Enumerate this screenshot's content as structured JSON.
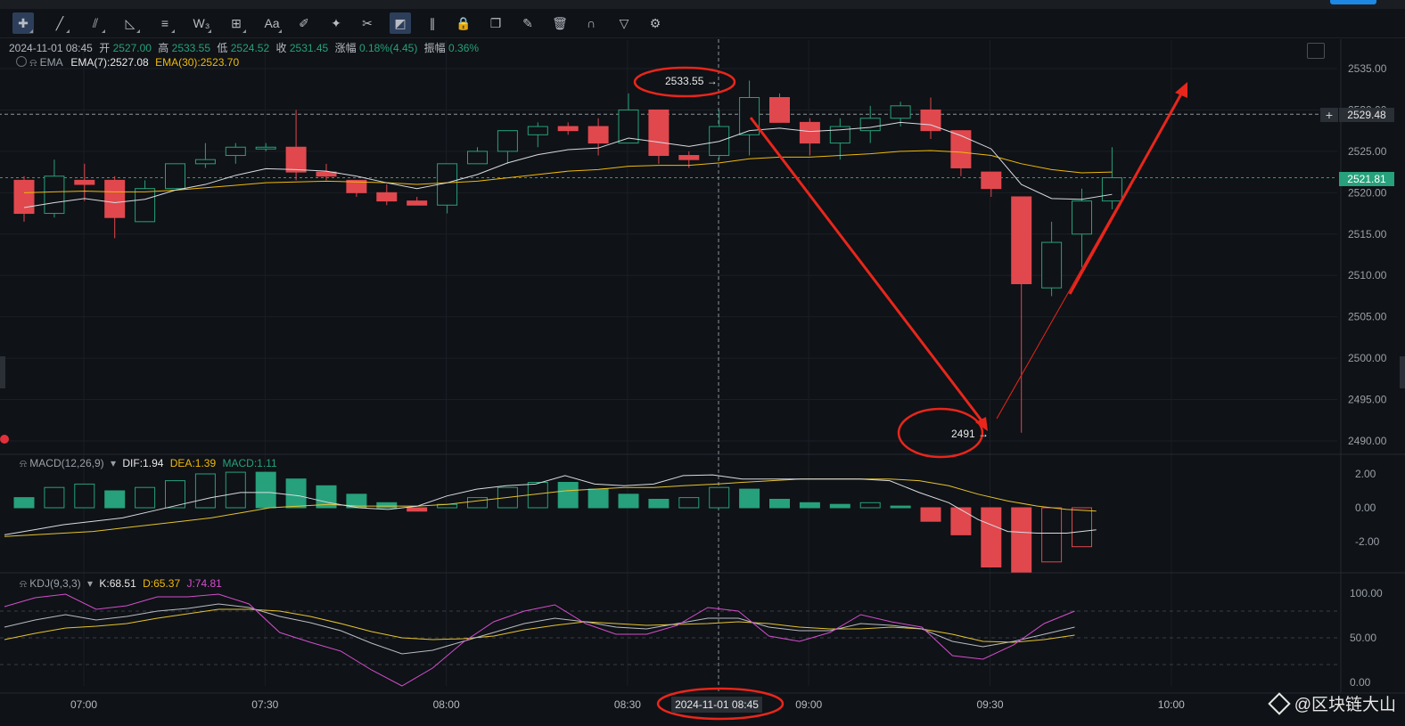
{
  "toolbar": {
    "tools": [
      "crosshair-icon",
      "trend-line-icon",
      "parallel-channel-icon",
      "fib-icon",
      "horizontal-line-icon",
      "pattern-icon",
      "measure-icon",
      "text-icon",
      "brush-icon",
      "highlighter-icon",
      "ruler-icon",
      "long-position-icon",
      "candles-icon",
      "lock-icon",
      "copy-icon",
      "edit-icon",
      "trash-icon",
      "magnet-icon",
      "filter-icon",
      "settings-icon"
    ]
  },
  "ohlc": {
    "datetime": "2024-11-01 08:45",
    "open_label": "开",
    "open": "2527.00",
    "high_label": "高",
    "high": "2533.55",
    "low_label": "低",
    "low": "2524.52",
    "close_label": "收",
    "close": "2531.45",
    "change_label": "涨幅",
    "change": "0.18%(4.45)",
    "amplitude_label": "振幅",
    "amplitude": "0.36%"
  },
  "ema": {
    "name": "EMA",
    "ema7": "EMA(7):2527.08",
    "ema30": "EMA(30):2523.70"
  },
  "macd": {
    "name": "MACD(12,26,9)",
    "dif": "DIF:1.94",
    "dea": "DEA:1.39",
    "macd": "MACD:1.11"
  },
  "kdj": {
    "name": "KDJ(9,3,3)",
    "k": "K:68.51",
    "d": "D:65.37",
    "j": "J:74.81"
  },
  "price_tags": {
    "crosshair": "2529.48",
    "last": "2521.81"
  },
  "annotations": {
    "high": "2533.55",
    "low": "2491"
  },
  "crosshair_time": "2024-11-01 08:45",
  "watermark": "@区块链大山",
  "colors": {
    "up": "#26a17b",
    "down": "#e0484e",
    "ema7": "#d9dce1",
    "ema30": "#f0b90b",
    "k": "#b9bcc2",
    "d": "#e5c330",
    "j": "#d44ecf",
    "annotation": "#e8261c"
  },
  "chart_data": [
    {
      "type": "candlestick",
      "title": "",
      "x_ticks": [
        "07:00",
        "07:30",
        "08:00",
        "08:30",
        "09:00",
        "09:30",
        "10:00"
      ],
      "y_ticks": [
        "2535.00",
        "2530.00",
        "2525.00",
        "2520.00",
        "2515.00",
        "2510.00",
        "2505.00",
        "2500.00",
        "2495.00",
        "2490.00"
      ],
      "ylim": [
        2488,
        2537
      ],
      "interval_minutes": 5,
      "x_start": "06:55",
      "candles": [
        {
          "o": 2521.5,
          "h": 2522.0,
          "l": 2516.5,
          "c": 2517.5
        },
        {
          "o": 2517.5,
          "h": 2524.0,
          "l": 2517.0,
          "c": 2522.0
        },
        {
          "o": 2521.5,
          "h": 2523.5,
          "l": 2519.0,
          "c": 2521.0
        },
        {
          "o": 2521.5,
          "h": 2522.0,
          "l": 2514.5,
          "c": 2517.0
        },
        {
          "o": 2516.5,
          "h": 2521.5,
          "l": 2516.5,
          "c": 2520.5
        },
        {
          "o": 2520.5,
          "h": 2523.5,
          "l": 2520.5,
          "c": 2523.5
        },
        {
          "o": 2523.5,
          "h": 2526.0,
          "l": 2523.0,
          "c": 2524.0
        },
        {
          "o": 2524.5,
          "h": 2526.0,
          "l": 2523.5,
          "c": 2525.5
        },
        {
          "o": 2525.5,
          "h": 2526.0,
          "l": 2525.0,
          "c": 2525.5
        },
        {
          "o": 2525.5,
          "h": 2530.0,
          "l": 2521.5,
          "c": 2522.5
        },
        {
          "o": 2522.5,
          "h": 2523.5,
          "l": 2521.5,
          "c": 2522.0
        },
        {
          "o": 2521.5,
          "h": 2521.5,
          "l": 2519.5,
          "c": 2520.0
        },
        {
          "o": 2520.0,
          "h": 2521.0,
          "l": 2518.5,
          "c": 2519.0
        },
        {
          "o": 2519.0,
          "h": 2519.5,
          "l": 2518.5,
          "c": 2518.5
        },
        {
          "o": 2518.5,
          "h": 2523.5,
          "l": 2517.5,
          "c": 2523.5
        },
        {
          "o": 2523.5,
          "h": 2525.5,
          "l": 2523.5,
          "c": 2525.0
        },
        {
          "o": 2525.0,
          "h": 2527.5,
          "l": 2523.5,
          "c": 2527.5
        },
        {
          "o": 2527.0,
          "h": 2528.5,
          "l": 2525.5,
          "c": 2528.0
        },
        {
          "o": 2528.0,
          "h": 2528.5,
          "l": 2527.0,
          "c": 2527.5
        },
        {
          "o": 2528.0,
          "h": 2529.0,
          "l": 2524.5,
          "c": 2526.0
        },
        {
          "o": 2526.0,
          "h": 2532.0,
          "l": 2526.0,
          "c": 2530.0
        },
        {
          "o": 2530.0,
          "h": 2530.0,
          "l": 2523.5,
          "c": 2524.5
        },
        {
          "o": 2524.5,
          "h": 2525.0,
          "l": 2523.0,
          "c": 2524.0
        },
        {
          "o": 2524.5,
          "h": 2530.0,
          "l": 2524.0,
          "c": 2528.0
        },
        {
          "o": 2527.0,
          "h": 2533.55,
          "l": 2524.5,
          "c": 2531.5
        },
        {
          "o": 2531.5,
          "h": 2532.0,
          "l": 2528.5,
          "c": 2528.5
        },
        {
          "o": 2528.5,
          "h": 2529.0,
          "l": 2524.5,
          "c": 2526.0
        },
        {
          "o": 2526.0,
          "h": 2529.0,
          "l": 2524.0,
          "c": 2528.0
        },
        {
          "o": 2527.5,
          "h": 2530.5,
          "l": 2526.0,
          "c": 2529.0
        },
        {
          "o": 2529.0,
          "h": 2531.0,
          "l": 2528.0,
          "c": 2530.5
        },
        {
          "o": 2530.0,
          "h": 2531.5,
          "l": 2526.5,
          "c": 2527.5
        },
        {
          "o": 2527.5,
          "h": 2527.5,
          "l": 2522.0,
          "c": 2523.0
        },
        {
          "o": 2522.5,
          "h": 2522.5,
          "l": 2519.5,
          "c": 2520.5
        },
        {
          "o": 2519.5,
          "h": 2519.5,
          "l": 2491.0,
          "c": 2509.0
        },
        {
          "o": 2508.5,
          "h": 2516.5,
          "l": 2507.5,
          "c": 2514.0
        },
        {
          "o": 2515.0,
          "h": 2520.5,
          "l": 2511.0,
          "c": 2519.0
        },
        {
          "o": 2519.0,
          "h": 2525.5,
          "l": 2518.0,
          "c": 2521.81
        }
      ],
      "ema7": [
        2518.2,
        2518.8,
        2519.3,
        2518.8,
        2519.2,
        2520.3,
        2521.0,
        2522.1,
        2522.9,
        2522.8,
        2522.6,
        2522.0,
        2521.2,
        2520.5,
        2521.2,
        2522.2,
        2523.6,
        2524.6,
        2525.2,
        2525.4,
        2526.6,
        2526.1,
        2525.6,
        2526.2,
        2527.5,
        2527.8,
        2527.4,
        2527.6,
        2527.9,
        2528.5,
        2528.2,
        2526.9,
        2525.3,
        2521.0,
        2519.3,
        2519.2,
        2519.8
      ],
      "ema30": [
        2520.0,
        2520.1,
        2520.2,
        2520.1,
        2520.1,
        2520.3,
        2520.6,
        2520.9,
        2521.2,
        2521.3,
        2521.4,
        2521.3,
        2521.2,
        2521.0,
        2521.2,
        2521.4,
        2521.8,
        2522.2,
        2522.6,
        2522.8,
        2523.2,
        2523.3,
        2523.3,
        2523.6,
        2524.1,
        2524.3,
        2524.3,
        2524.5,
        2524.7,
        2525.0,
        2525.1,
        2524.9,
        2524.5,
        2523.5,
        2522.8,
        2522.4,
        2522.5
      ]
    },
    {
      "type": "bar",
      "title": "MACD(12,26,9)",
      "y_ticks": [
        "2.00",
        "0.00",
        "-2.00"
      ],
      "ylim": [
        -4,
        2.6
      ],
      "hist": [
        0.6,
        1.2,
        1.4,
        1.0,
        1.2,
        1.6,
        2.0,
        2.1,
        2.1,
        1.7,
        1.3,
        0.8,
        0.3,
        -0.2,
        0.2,
        0.6,
        1.2,
        1.5,
        1.5,
        1.1,
        0.8,
        0.5,
        0.6,
        1.2,
        1.1,
        0.5,
        0.3,
        0.2,
        0.3,
        0.1,
        -0.8,
        -1.6,
        -3.5,
        -3.8,
        -3.2,
        -2.3
      ],
      "dif": [
        -1.6,
        -1.3,
        -1.0,
        -0.8,
        -0.6,
        -0.2,
        0.2,
        0.6,
        0.9,
        0.9,
        0.7,
        0.3,
        0.0,
        -0.1,
        0.1,
        0.7,
        1.1,
        1.3,
        1.4,
        1.9,
        1.4,
        1.3,
        1.4,
        1.9,
        1.94,
        1.7,
        1.7,
        1.7,
        1.7,
        1.7,
        1.6,
        0.9,
        0.3,
        -0.7,
        -1.4,
        -1.5,
        -1.5,
        -1.3
      ],
      "dea": [
        -1.7,
        -1.6,
        -1.5,
        -1.4,
        -1.2,
        -1.0,
        -0.8,
        -0.6,
        -0.3,
        0.0,
        0.1,
        0.2,
        0.1,
        0.1,
        0.1,
        0.2,
        0.4,
        0.6,
        0.8,
        1.0,
        1.1,
        1.2,
        1.2,
        1.3,
        1.39,
        1.5,
        1.6,
        1.7,
        1.7,
        1.7,
        1.7,
        1.6,
        1.3,
        0.8,
        0.4,
        0.1,
        -0.1,
        -0.2
      ]
    },
    {
      "type": "line",
      "title": "KDJ(9,3,3)",
      "y_ticks": [
        "100.00",
        "50.00",
        "0.00"
      ],
      "ylim": [
        -5,
        110
      ],
      "k": [
        62,
        70,
        76,
        70,
        74,
        80,
        83,
        88,
        84,
        74,
        67,
        58,
        44,
        32,
        36,
        46,
        56,
        66,
        72,
        68,
        62,
        60,
        66,
        72,
        72,
        62,
        58,
        58,
        66,
        64,
        60,
        46,
        40,
        46,
        54,
        62
      ],
      "d": [
        48,
        55,
        61,
        63,
        66,
        72,
        77,
        82,
        82,
        80,
        74,
        66,
        57,
        50,
        48,
        49,
        52,
        59,
        64,
        68,
        66,
        64,
        65,
        66,
        68,
        66,
        62,
        60,
        60,
        62,
        60,
        54,
        46,
        45,
        48,
        53
      ],
      "j": [
        85,
        95,
        99,
        82,
        86,
        96,
        96,
        99,
        88,
        56,
        45,
        35,
        14,
        -4,
        16,
        45,
        68,
        80,
        87,
        66,
        54,
        54,
        64,
        84,
        80,
        52,
        46,
        56,
        76,
        68,
        62,
        30,
        26,
        42,
        66,
        80
      ]
    }
  ]
}
